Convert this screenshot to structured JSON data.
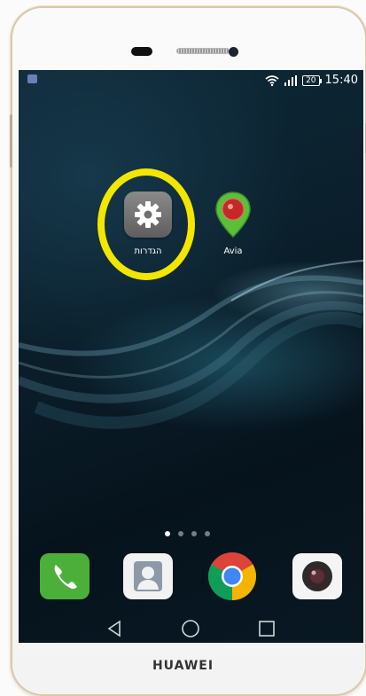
{
  "device": {
    "brand": "HUAWEI"
  },
  "status_bar": {
    "time": "15:40",
    "battery": "20",
    "icons": [
      "notification-icon",
      "wifi-icon",
      "signal-icon",
      "battery-icon"
    ]
  },
  "home_apps": [
    {
      "label": "הגדרות",
      "icon": "gear-icon"
    },
    {
      "label": "Avia",
      "icon": "map-pin-icon"
    }
  ],
  "page_indicator": {
    "count": 4,
    "active": 1
  },
  "dock": [
    {
      "icon": "phone-icon"
    },
    {
      "icon": "contacts-icon"
    },
    {
      "icon": "chrome-icon"
    },
    {
      "icon": "camera-icon"
    }
  ],
  "nav_bar": {
    "icons": [
      "back-icon",
      "home-icon",
      "recents-icon"
    ]
  },
  "colors": {
    "highlight_ring": "#f3e600",
    "phone_green": "#4caf3a"
  }
}
